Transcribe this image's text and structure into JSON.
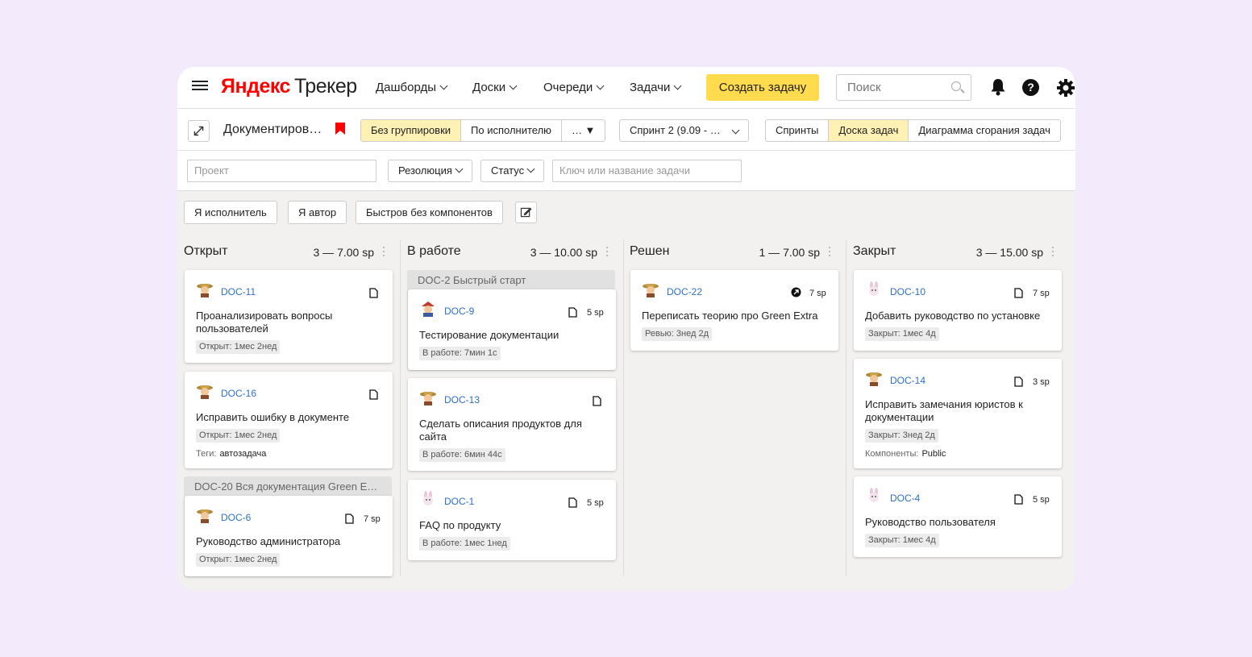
{
  "header": {
    "logo_brand": "Яндекс",
    "logo_product": "Трекер",
    "nav": [
      "Дашборды",
      "Доски",
      "Очереди",
      "Задачи"
    ],
    "create_button": "Создать задачу",
    "search_placeholder": "Поиск",
    "help_glyph": "?"
  },
  "toolbar": {
    "board_title": "Документиров…",
    "grouping": [
      "Без группировки",
      "По исполнителю",
      "… ▼"
    ],
    "sprint": "Спринт 2 (9.09 - …",
    "views": [
      "Спринты",
      "Доска задач",
      "Диаграмма сгорания задач"
    ]
  },
  "filters": {
    "project_placeholder": "Проект",
    "resolution": "Резолюция",
    "status": "Статус",
    "key_placeholder": "Ключ или название задачи"
  },
  "quick_filters": [
    "Я исполнитель",
    "Я автор",
    "Быстров без компонентов"
  ],
  "columns": [
    {
      "name": "Открыт",
      "stat": "3 — 7.00 sp",
      "cards": [
        {
          "key": "DOC-11",
          "title": "Проанализировать вопросы пользователей",
          "badge": "Открыт: 1мес 2нед",
          "sp": ""
        },
        {
          "key": "DOC-16",
          "title": "Исправить ошибку в документе",
          "badge": "Открыт: 1мес 2нед",
          "sp": "",
          "meta_label": "Теги:",
          "meta_value": "автозадача"
        }
      ],
      "group": {
        "title": "DOC-20 Вся документация Green E…",
        "cards": [
          {
            "key": "DOC-6",
            "title": "Руководство администратора",
            "badge": "Открыт: 1мес 2нед",
            "sp": "7 sp"
          }
        ]
      }
    },
    {
      "name": "В работе",
      "stat": "3 — 10.00 sp",
      "group": {
        "title": "DOC-2 Быстрый старт",
        "cards": [
          {
            "key": "DOC-9",
            "title": "Тестирование документации",
            "badge": "В работе: 7мин 1с",
            "sp": "5 sp"
          }
        ]
      },
      "cards": [
        {
          "key": "DOC-13",
          "title": "Сделать описания продуктов для сайта",
          "badge": "В работе: 6мин 44с",
          "sp": ""
        },
        {
          "key": "DOC-1",
          "title": "FAQ по продукту",
          "badge": "В работе: 1мес 1нед",
          "sp": "5 sp"
        }
      ]
    },
    {
      "name": "Решен",
      "stat": "1 — 7.00 sp",
      "cards": [
        {
          "key": "DOC-22",
          "title": "Переписать теорию про Green Extra",
          "badge": "Ревью: 3нед 2д",
          "sp": "7 sp"
        }
      ]
    },
    {
      "name": "Закрыт",
      "stat": "3 — 15.00 sp",
      "cards": [
        {
          "key": "DOC-10",
          "title": "Добавить руководство по установке",
          "badge": "Закрыт: 1мес 4д",
          "sp": "7 sp"
        },
        {
          "key": "DOC-14",
          "title": "Исправить замечания юристов к документации",
          "badge": "Закрыт: 3нед 2д",
          "sp": "3 sp",
          "meta_label": "Компоненты:",
          "meta_value": "Public"
        },
        {
          "key": "DOC-4",
          "title": "Руководство пользователя",
          "badge": "Закрыт: 1мес 4д",
          "sp": "5 sp"
        }
      ]
    }
  ],
  "colors": {
    "accent": "#ffdb4d",
    "active_segment": "#fff0b3",
    "link": "#2f6fca",
    "bookmark": "#ff0000",
    "background": "#f3eafc"
  }
}
